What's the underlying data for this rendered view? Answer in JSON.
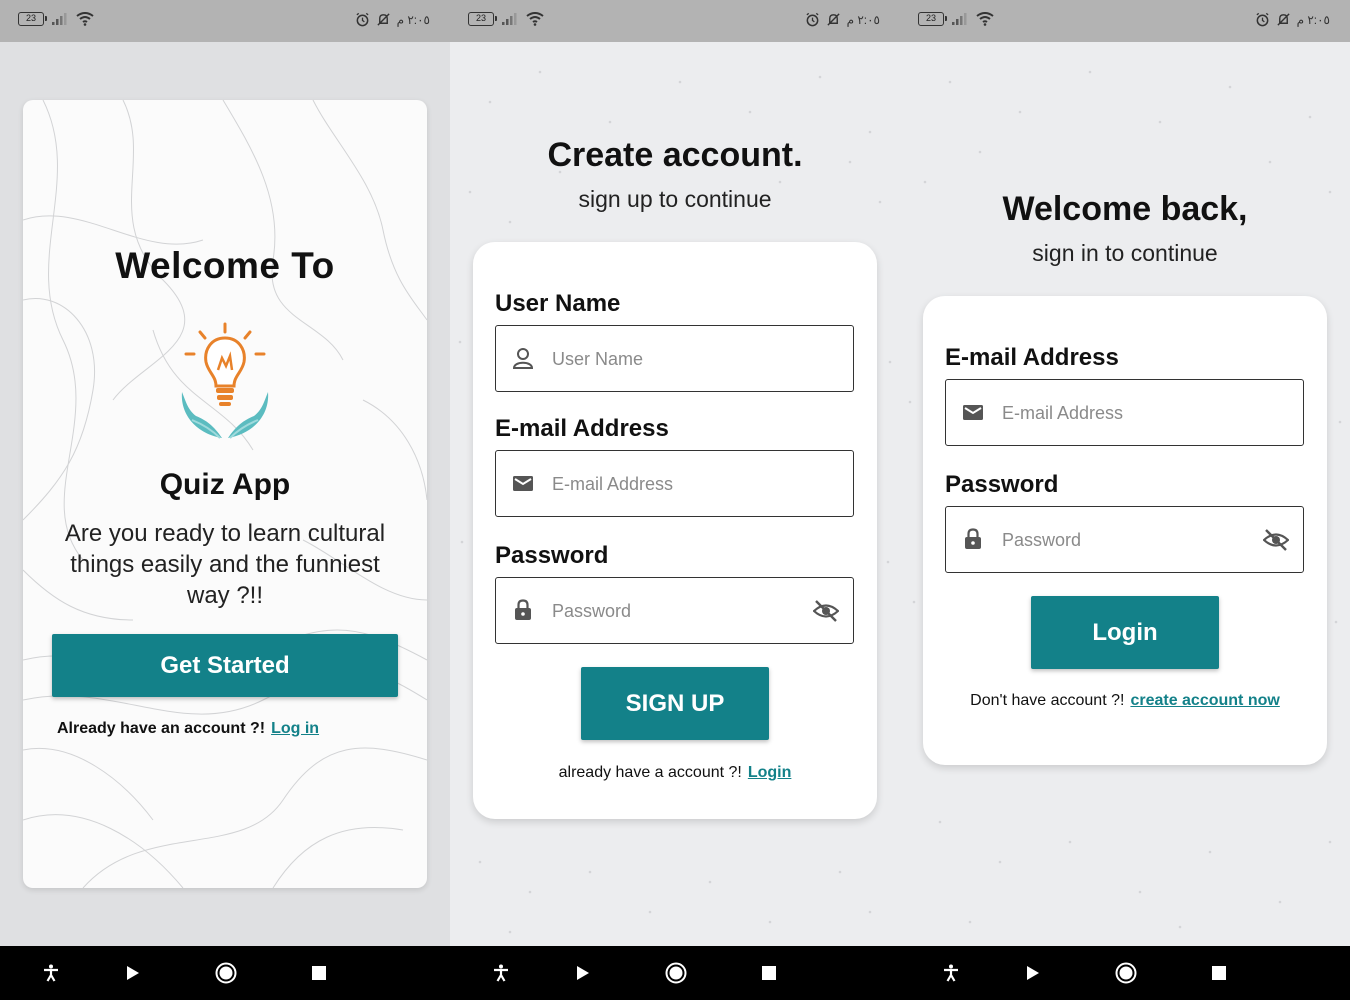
{
  "status_bar": {
    "battery": "23",
    "time": "٢:٠٥ م"
  },
  "welcome": {
    "title": "Welcome To",
    "app_name": "Quiz App",
    "tagline": "Are you ready to learn cultural things easily and the funniest way ?!!",
    "cta_label": "Get Started",
    "already_text": "Already have an account ?!",
    "login_link": "Log in"
  },
  "signup": {
    "title": "Create account.",
    "subtitle": "sign up to continue",
    "username_label": "User Name",
    "username_placeholder": "User Name",
    "email_label": "E-mail Address",
    "email_placeholder": "E-mail Address",
    "password_label": "Password",
    "password_placeholder": "Password",
    "submit_label": "SIGN UP",
    "already_text": "already have a account ?!",
    "login_link": "Login"
  },
  "login": {
    "title": "Welcome back,",
    "subtitle": "sign in to continue",
    "email_label": "E-mail Address",
    "email_placeholder": "E-mail Address",
    "password_label": "Password",
    "password_placeholder": "Password",
    "submit_label": "Login",
    "no_account_text": "Don't have account ?!",
    "create_link": "create account now"
  },
  "colors": {
    "accent": "#138189",
    "bulb_orange": "#e8822a",
    "hands_teal": "#5bbcc0"
  },
  "icons": [
    "battery-icon",
    "signal-icon",
    "wifi-icon",
    "alarm-icon",
    "bell-off-icon",
    "accessibility-icon",
    "play-icon",
    "home-icon",
    "recents-icon",
    "user-icon",
    "mail-icon",
    "lock-icon",
    "eye-off-icon",
    "bulb-icon"
  ]
}
